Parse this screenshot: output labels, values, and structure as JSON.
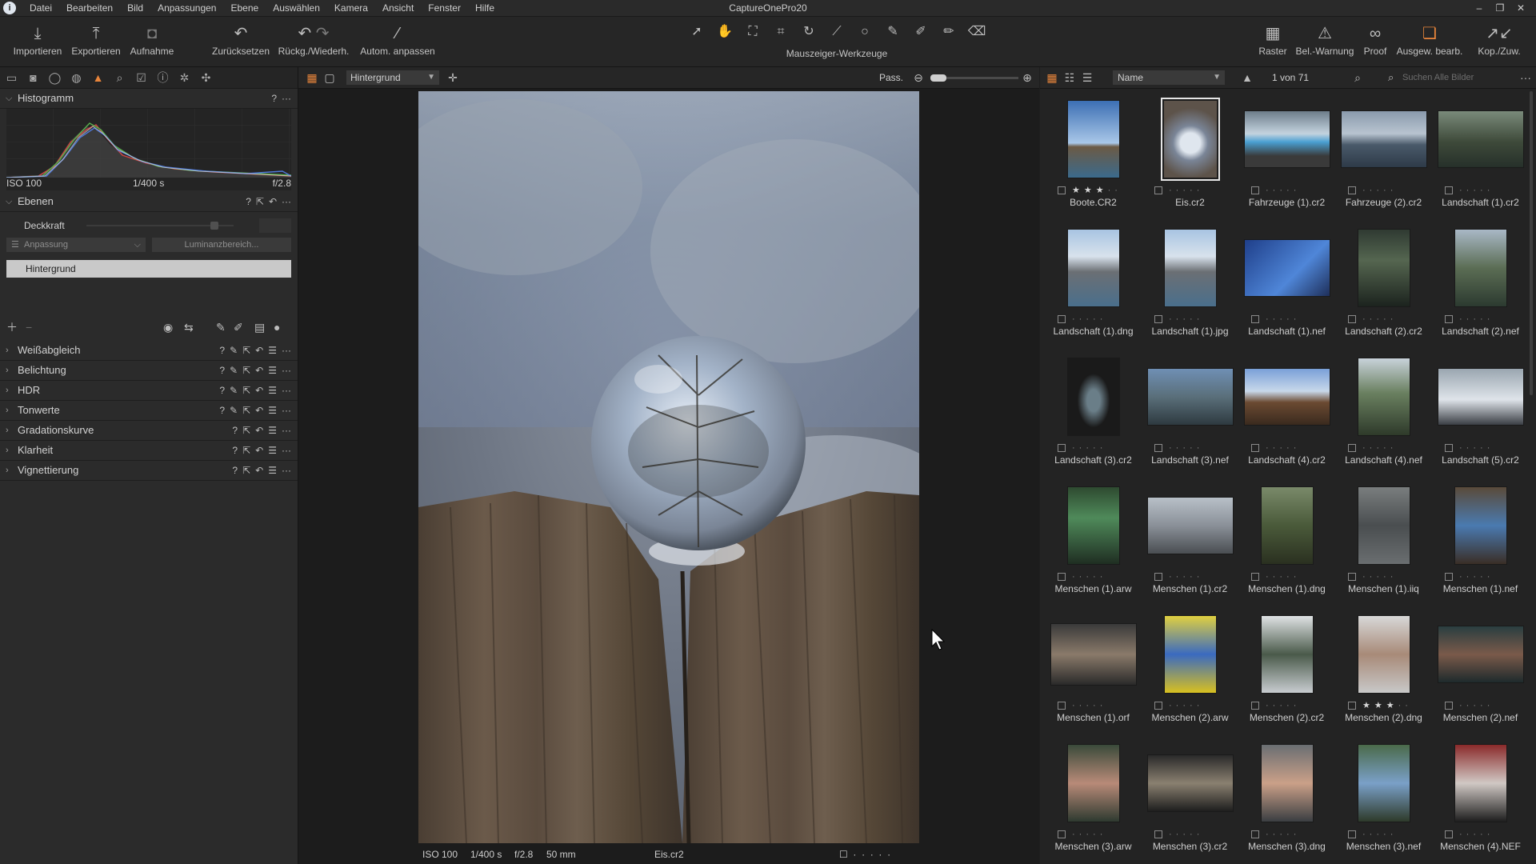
{
  "menubar": {
    "items": [
      "Datei",
      "Bearbeiten",
      "Bild",
      "Anpassungen",
      "Ebene",
      "Auswählen",
      "Kamera",
      "Ansicht",
      "Fenster",
      "Hilfe"
    ],
    "title": "CaptureOnePro20"
  },
  "toolbar": {
    "import": "Importieren",
    "export": "Exportieren",
    "capture": "Aufnahme",
    "reset": "Zurücksetzen",
    "undo_redo": "Rückg./Wiederh.",
    "auto_adjust": "Autom. anpassen",
    "cursor_tools": "Mauszeiger-Werkzeuge",
    "grid": "Raster",
    "exposure_warning": "Bel.-Warnung",
    "proof": "Proof",
    "edit_selected": "Ausgew. bearb.",
    "copy_apply": "Kop./Zuw."
  },
  "histogram": {
    "title": "Histogramm",
    "iso": "ISO 100",
    "shutter": "1/400 s",
    "aperture": "f/2.8"
  },
  "layers": {
    "title": "Ebenen",
    "opacity_label": "Deckkraft",
    "adjustment_select": "Anpassung",
    "luminance_button": "Luminanzbereich...",
    "background_layer": "Hintergrund"
  },
  "tools": [
    "Weißabgleich",
    "Belichtung",
    "HDR",
    "Tonwerte",
    "Gradationskurve",
    "Klarheit",
    "Vignettierung"
  ],
  "viewer": {
    "layer_select": "Hintergrund",
    "fit_label": "Pass.",
    "iso": "ISO 100",
    "shutter": "1/400 s",
    "aperture": "f/2.8",
    "focal": "50 mm",
    "filename": "Eis.cr2"
  },
  "browser": {
    "sort_by": "Name",
    "count": "1 von 71",
    "search_placeholder": "Suchen Alle Bilder",
    "items": [
      {
        "name": "Boote.CR2",
        "stars": 3
      },
      {
        "name": "Eis.cr2",
        "stars": 0,
        "selected": true
      },
      {
        "name": "Fahrzeuge (1).cr2",
        "stars": 0
      },
      {
        "name": "Fahrzeuge (2).cr2",
        "stars": 0
      },
      {
        "name": "Landschaft (1).cr2",
        "stars": 0
      },
      {
        "name": "Landschaft (1).dng",
        "stars": 0
      },
      {
        "name": "Landschaft (1).jpg",
        "stars": 0
      },
      {
        "name": "Landschaft (1).nef",
        "stars": 0
      },
      {
        "name": "Landschaft (2).cr2",
        "stars": 0
      },
      {
        "name": "Landschaft (2).nef",
        "stars": 0
      },
      {
        "name": "Landschaft (3).cr2",
        "stars": 0
      },
      {
        "name": "Landschaft (3).nef",
        "stars": 0
      },
      {
        "name": "Landschaft (4).cr2",
        "stars": 0
      },
      {
        "name": "Landschaft (4).nef",
        "stars": 0
      },
      {
        "name": "Landschaft (5).cr2",
        "stars": 0
      },
      {
        "name": "Menschen (1).arw",
        "stars": 0
      },
      {
        "name": "Menschen (1).cr2",
        "stars": 0
      },
      {
        "name": "Menschen (1).dng",
        "stars": 0
      },
      {
        "name": "Menschen (1).iiq",
        "stars": 0
      },
      {
        "name": "Menschen (1).nef",
        "stars": 0
      },
      {
        "name": "Menschen (1).orf",
        "stars": 0
      },
      {
        "name": "Menschen (2).arw",
        "stars": 0
      },
      {
        "name": "Menschen (2).cr2",
        "stars": 0
      },
      {
        "name": "Menschen (2).dng",
        "stars": 3
      },
      {
        "name": "Menschen (2).nef",
        "stars": 0
      },
      {
        "name": "Menschen (3).arw",
        "stars": 0
      },
      {
        "name": "Menschen (3).cr2",
        "stars": 0
      },
      {
        "name": "Menschen (3).dng",
        "stars": 0
      },
      {
        "name": "Menschen (3).nef",
        "stars": 0
      },
      {
        "name": "Menschen (4).NEF",
        "stars": 0
      }
    ]
  },
  "colors": {
    "accent": "#e8853b"
  }
}
